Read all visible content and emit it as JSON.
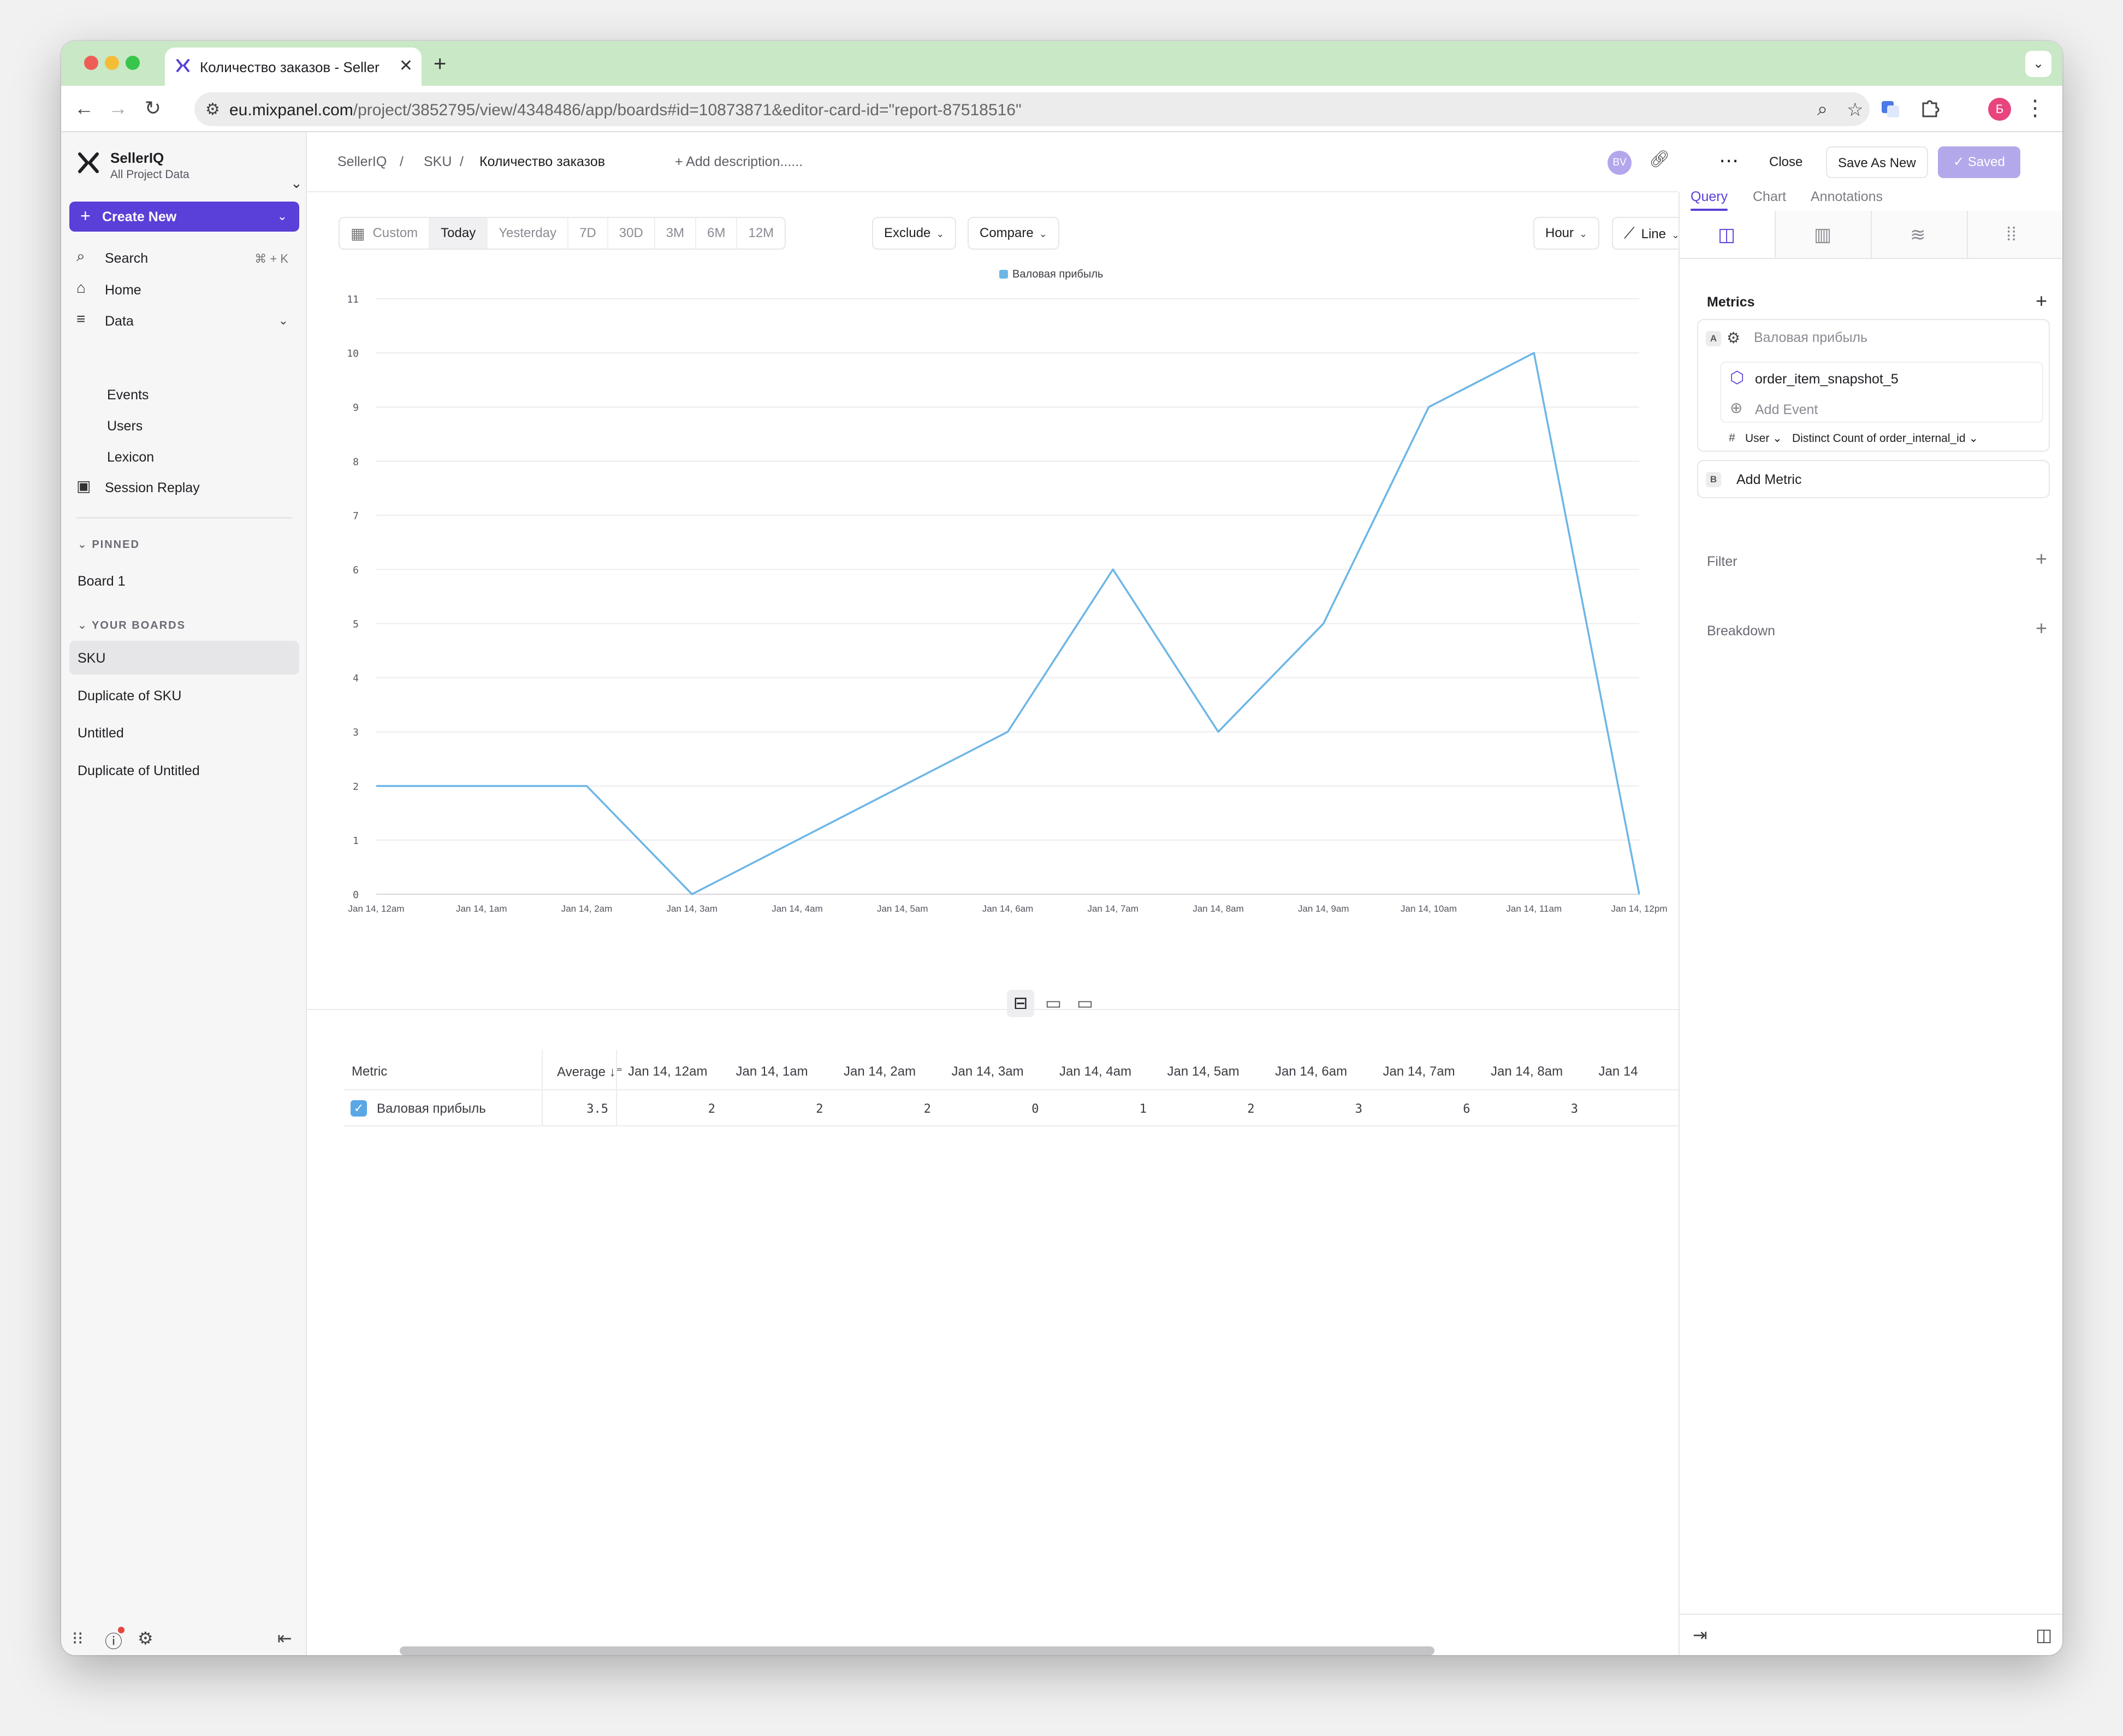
{
  "browser": {
    "tab_title": "Количество заказов - SellerIQ",
    "url_host": "eu.mixpanel.com",
    "url_path": "/project/3852795/view/4348486/app/boards#id=10873871&editor-card-id=\"report-87518516\"",
    "profile_initial": "Б"
  },
  "sidebar": {
    "org_name": "SellerIQ",
    "org_sub": "All Project Data",
    "create_label": "Create New",
    "nav": {
      "search": "Search",
      "search_kbd": "⌘ + K",
      "home": "Home",
      "data": "Data",
      "events": "Events",
      "users": "Users",
      "lexicon": "Lexicon",
      "session_replay": "Session Replay"
    },
    "pinned_label": "PINNED",
    "pinned": [
      "Board 1"
    ],
    "boards_label": "YOUR BOARDS",
    "boards": [
      "SKU",
      "Duplicate of SKU",
      "Untitled",
      "Duplicate of Untitled"
    ]
  },
  "header": {
    "crumbs": [
      "SellerIQ",
      "SKU",
      "Количество заказов"
    ],
    "add_description": "+ Add description......",
    "avatar": "BV",
    "close": "Close",
    "save_as_new": "Save As New",
    "saved": "Saved"
  },
  "toolbar": {
    "custom": "Custom",
    "ranges": [
      "Today",
      "Yesterday",
      "7D",
      "30D",
      "3M",
      "6M",
      "12M"
    ],
    "exclude": "Exclude",
    "compare": "Compare",
    "interval": "Hour",
    "chart_type": "Line"
  },
  "chart_data": {
    "type": "line",
    "legend_position": "top-center",
    "grid": true,
    "x": [
      "Jan 14, 12am",
      "Jan 14, 1am",
      "Jan 14, 2am",
      "Jan 14, 3am",
      "Jan 14, 4am",
      "Jan 14, 5am",
      "Jan 14, 6am",
      "Jan 14, 7am",
      "Jan 14, 8am",
      "Jan 14, 9am",
      "Jan 14, 10am",
      "Jan 14, 11am",
      "Jan 14, 12pm"
    ],
    "y_ticks": [
      0,
      1,
      2,
      3,
      4,
      5,
      6,
      7,
      8,
      9,
      10,
      11
    ],
    "ylim": [
      0,
      11
    ],
    "series": [
      {
        "name": "Валовая прибыль",
        "color": "#6cb6e6",
        "values": [
          2,
          2,
          2,
          0,
          1,
          2,
          3,
          6,
          3,
          5,
          9,
          10,
          0
        ]
      }
    ]
  },
  "table": {
    "metric_header": "Metric",
    "average_header": "Average",
    "columns": [
      "Jan 14, 12am",
      "Jan 14, 1am",
      "Jan 14, 2am",
      "Jan 14, 3am",
      "Jan 14, 4am",
      "Jan 14, 5am",
      "Jan 14, 6am",
      "Jan 14, 7am",
      "Jan 14, 8am",
      "Jan 14"
    ],
    "row_name": "Валовая прибыль",
    "row_average": "3.5",
    "row_values": [
      "2",
      "2",
      "2",
      "0",
      "1",
      "2",
      "3",
      "6",
      "3",
      ""
    ]
  },
  "panel": {
    "tabs": [
      "Query",
      "Chart",
      "Annotations"
    ],
    "metrics_title": "Metrics",
    "metric_a_letter": "A",
    "metric_a_name": "Валовая прибыль",
    "event_name": "order_item_snapshot_5",
    "add_event": "Add Event",
    "hash": "#",
    "user_label": "User",
    "measure": "Distinct Count of order_internal_id",
    "metric_b_letter": "B",
    "add_metric": "Add Metric",
    "filter": "Filter",
    "breakdown": "Breakdown"
  }
}
